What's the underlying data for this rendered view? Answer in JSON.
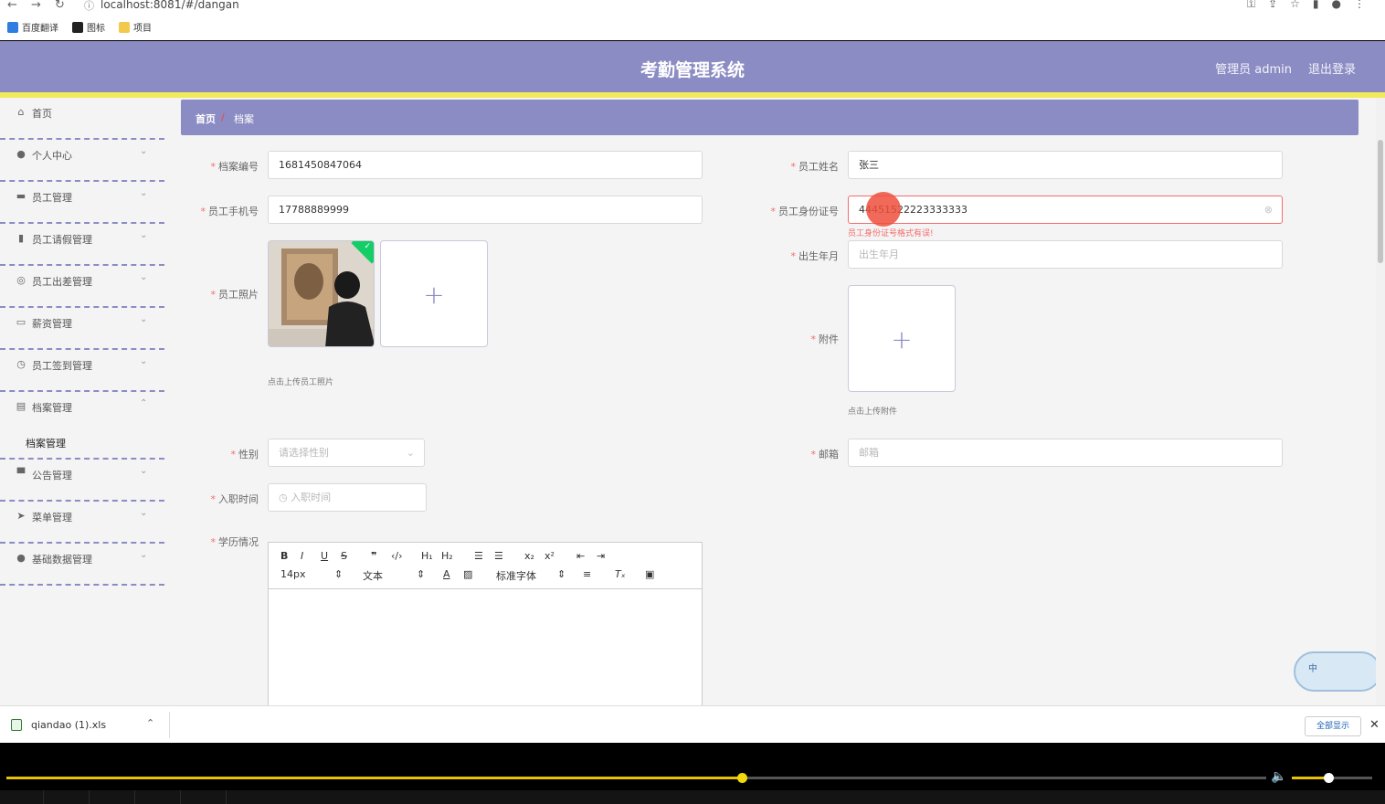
{
  "browser": {
    "url": "localhost:8081/#/dangan",
    "bookmarks": [
      {
        "label": "百度翻译",
        "color": "#2f7de1"
      },
      {
        "label": "图标",
        "color": "#222222"
      },
      {
        "label": "项目",
        "color": "#f2c94c"
      }
    ]
  },
  "header": {
    "title": "考勤管理系统",
    "admin_label": "管理员 admin",
    "logout_label": "退出登录",
    "bg_color": "#8c8cc4",
    "accent_line_color": "#f2ea5a"
  },
  "sidebar": {
    "items": [
      {
        "label": "首页",
        "icon": "home-icon"
      },
      {
        "label": "个人中心",
        "icon": "user-icon"
      },
      {
        "label": "员工管理",
        "icon": "briefcase-icon"
      },
      {
        "label": "员工请假管理",
        "icon": "bar-chart-icon"
      },
      {
        "label": "员工出差管理",
        "icon": "globe-icon"
      },
      {
        "label": "薪资管理",
        "icon": "wallet-icon"
      },
      {
        "label": "员工签到管理",
        "icon": "clock-icon"
      },
      {
        "label": "档案管理",
        "icon": "document-icon"
      },
      {
        "label": "公告管理",
        "icon": "monitor-icon"
      },
      {
        "label": "菜单管理",
        "icon": "send-icon"
      },
      {
        "label": "基础数据管理",
        "icon": "user-icon"
      }
    ],
    "open_submenu_label": "档案管理"
  },
  "breadcrumb": {
    "home": "首页",
    "separator": "/",
    "current": "档案"
  },
  "form": {
    "archive_no": {
      "label": "档案编号",
      "value": "1681450847064"
    },
    "employee_name": {
      "label": "员工姓名",
      "value": "张三"
    },
    "phone": {
      "label": "员工手机号",
      "value": "17788889999"
    },
    "id_card": {
      "label": "员工身份证号",
      "value": "44451522223333333",
      "error": "员工身份证号格式有误!"
    },
    "birth": {
      "label": "出生年月",
      "placeholder": "出生年月"
    },
    "photo": {
      "label": "员工照片",
      "hint": "点击上传员工照片"
    },
    "attachment": {
      "label": "附件",
      "hint": "点击上传附件"
    },
    "gender": {
      "label": "性别",
      "placeholder": "请选择性别"
    },
    "email": {
      "label": "邮箱",
      "placeholder": "邮箱"
    },
    "hire_date": {
      "label": "入职时间",
      "placeholder": "入职时间"
    },
    "education": {
      "label": "学历情况"
    },
    "required_mark": "*",
    "plus": "+"
  },
  "editor": {
    "font_size": "14px",
    "text_type": "文本",
    "font_family": "标准字体"
  },
  "widget": {
    "label": "中"
  },
  "downloads": {
    "file": "qiandao (1).xls",
    "show_all": "全部显示"
  },
  "player": {
    "progress": 0.584,
    "volume": 0.45
  }
}
